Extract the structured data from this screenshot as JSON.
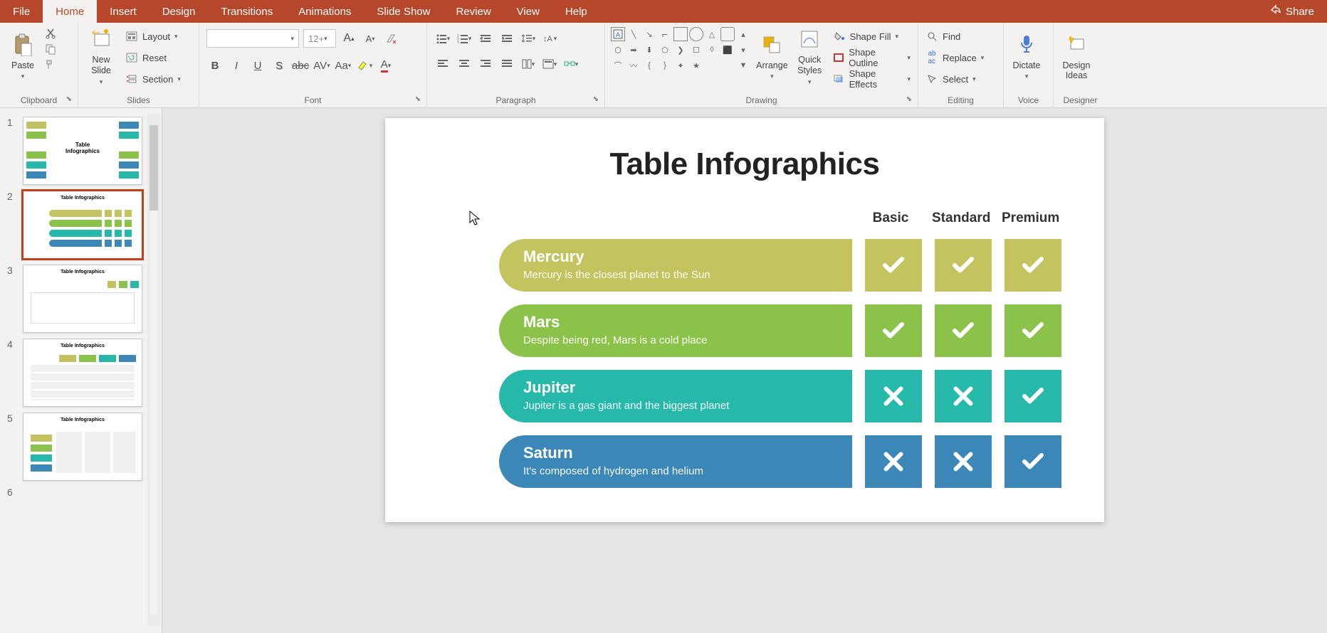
{
  "tabs": [
    "File",
    "Home",
    "Insert",
    "Design",
    "Transitions",
    "Animations",
    "Slide Show",
    "Review",
    "View",
    "Help"
  ],
  "active_tab": "Home",
  "share": "Share",
  "ribbon": {
    "clipboard": {
      "label": "Clipboard",
      "paste": "Paste"
    },
    "slides": {
      "label": "Slides",
      "new_slide": "New\nSlide",
      "layout": "Layout",
      "reset": "Reset",
      "section": "Section"
    },
    "font": {
      "label": "Font",
      "size": "12+"
    },
    "paragraph": {
      "label": "Paragraph"
    },
    "drawing": {
      "label": "Drawing",
      "arrange": "Arrange",
      "quick_styles": "Quick\nStyles",
      "shape_fill": "Shape Fill",
      "shape_outline": "Shape Outline",
      "shape_effects": "Shape Effects"
    },
    "editing": {
      "label": "Editing",
      "find": "Find",
      "replace": "Replace",
      "select": "Select"
    },
    "voice": {
      "label": "Voice",
      "dictate": "Dictate"
    },
    "designer": {
      "label": "Designer",
      "design_ideas": "Design\nIdeas"
    }
  },
  "thumbnails": [
    {
      "num": "1",
      "title": "Table\nInfographics"
    },
    {
      "num": "2",
      "title": "Table Infographics",
      "selected": true
    },
    {
      "num": "3",
      "title": "Table Infographics"
    },
    {
      "num": "4",
      "title": "Table Infographics"
    },
    {
      "num": "5",
      "title": "Table Infographics"
    },
    {
      "num": "6"
    }
  ],
  "slide": {
    "title": "Table Infographics",
    "columns": [
      "Basic",
      "Standard",
      "Premium"
    ],
    "rows": [
      {
        "name": "Mercury",
        "desc": "Mercury is the closest planet to the Sun",
        "color": "c-olive",
        "cells": [
          "check",
          "check",
          "check"
        ]
      },
      {
        "name": "Mars",
        "desc": "Despite being red, Mars is a cold place",
        "color": "c-green",
        "cells": [
          "check",
          "check",
          "check"
        ]
      },
      {
        "name": "Jupiter",
        "desc": "Jupiter is a gas giant and the biggest planet",
        "color": "c-teal",
        "cells": [
          "cross",
          "cross",
          "check"
        ]
      },
      {
        "name": "Saturn",
        "desc": "It's composed of hydrogen and helium",
        "color": "c-blue",
        "cells": [
          "cross",
          "cross",
          "check"
        ]
      }
    ]
  }
}
